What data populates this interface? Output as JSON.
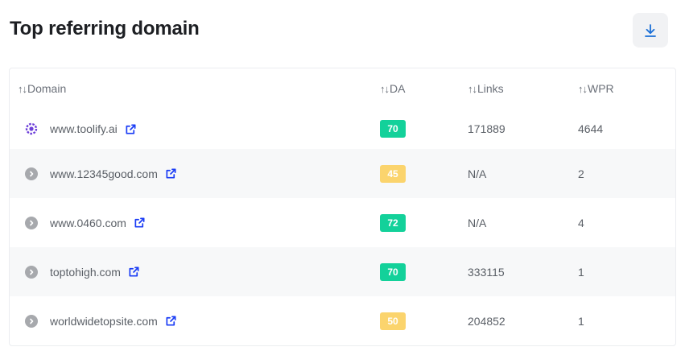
{
  "title": "Top referring domain",
  "download": {
    "icon": "download-icon"
  },
  "columns": {
    "sort_icon": "↑↓",
    "domain": "Domain",
    "da": "DA",
    "links": "Links",
    "wpr": "WPR"
  },
  "colors": {
    "green_badge": "#13d19a",
    "yellow_badge": "#fbd46d",
    "link_icon": "#1a3cf5",
    "favicon_purple": "#6d3fd9"
  },
  "rows": [
    {
      "domain": "www.toolify.ai",
      "favicon": "toolify-favicon-icon",
      "da": "70",
      "da_color": "green",
      "links": "171889",
      "wpr": "4644"
    },
    {
      "domain": "www.12345good.com",
      "favicon": "chevron-right-circle-icon",
      "da": "45",
      "da_color": "yellow",
      "links": "N/A",
      "wpr": "2"
    },
    {
      "domain": "www.0460.com",
      "favicon": "chevron-right-circle-icon",
      "da": "72",
      "da_color": "green",
      "links": "N/A",
      "wpr": "4"
    },
    {
      "domain": "toptohigh.com",
      "favicon": "chevron-right-circle-icon",
      "da": "70",
      "da_color": "green",
      "links": "333115",
      "wpr": "1"
    },
    {
      "domain": "worldwidetopsite.com",
      "favicon": "chevron-right-circle-icon",
      "da": "50",
      "da_color": "yellow",
      "links": "204852",
      "wpr": "1"
    }
  ]
}
